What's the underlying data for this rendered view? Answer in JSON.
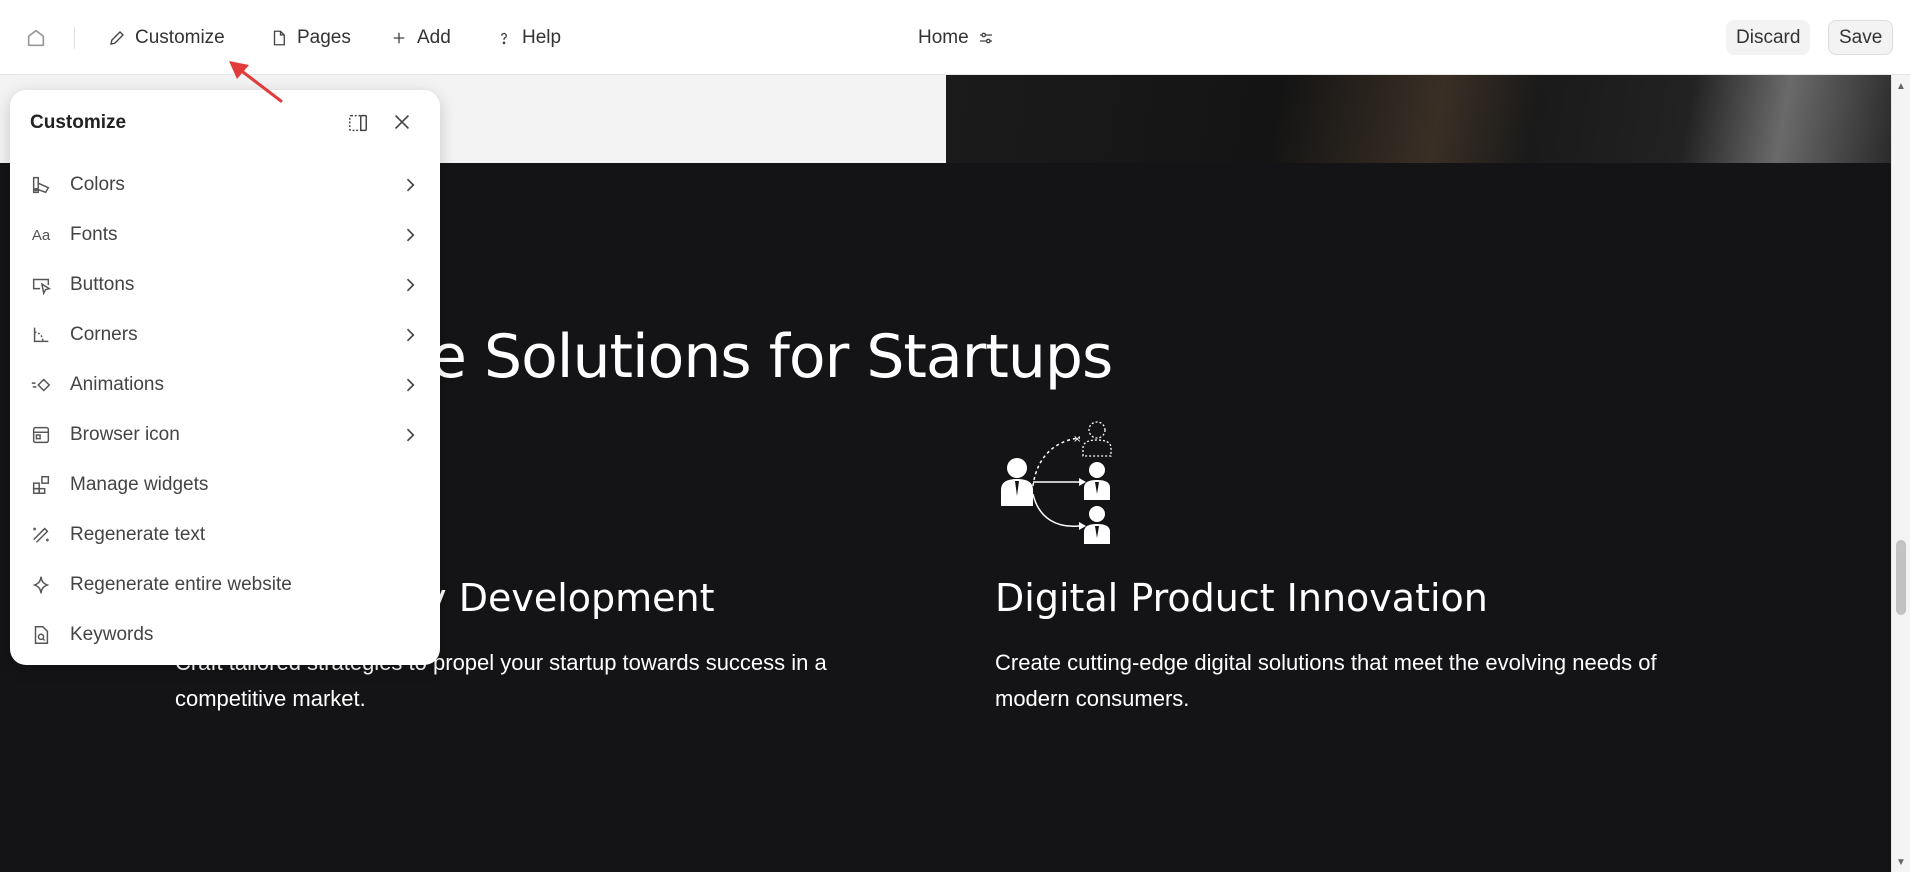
{
  "toolbar": {
    "customize": "Customize",
    "pages": "Pages",
    "add": "Add",
    "help": "Help",
    "page_name": "Home",
    "discard": "Discard",
    "save": "Save"
  },
  "panel": {
    "title": "Customize",
    "items": [
      {
        "label": "Colors",
        "icon": "palette-icon",
        "has_submenu": true
      },
      {
        "label": "Fonts",
        "icon": "font-icon",
        "has_submenu": true
      },
      {
        "label": "Buttons",
        "icon": "button-pointer-icon",
        "has_submenu": true
      },
      {
        "label": "Corners",
        "icon": "corner-icon",
        "has_submenu": true
      },
      {
        "label": "Animations",
        "icon": "animation-icon",
        "has_submenu": true
      },
      {
        "label": "Browser icon",
        "icon": "browser-icon",
        "has_submenu": true
      },
      {
        "label": "Manage widgets",
        "icon": "widgets-icon",
        "has_submenu": false
      },
      {
        "label": "Regenerate text",
        "icon": "magic-wand-icon",
        "has_submenu": false
      },
      {
        "label": "Regenerate entire website",
        "icon": "sparkle-icon",
        "has_submenu": false
      },
      {
        "label": "Keywords",
        "icon": "keyword-document-icon",
        "has_submenu": false
      }
    ]
  },
  "page": {
    "headline": "e Solutions for Startups",
    "card_left": {
      "title": "gy Development",
      "description": "Craft tailored strategies to propel your startup towards success in a competitive market."
    },
    "card_right": {
      "title": "Digital Product Innovation",
      "description": "Create cutting-edge digital solutions that meet the evolving needs of modern consumers."
    }
  },
  "colors": {
    "dark_bg": "#141416",
    "annotation": "#e23b3b",
    "panel_bg": "#ffffff"
  }
}
